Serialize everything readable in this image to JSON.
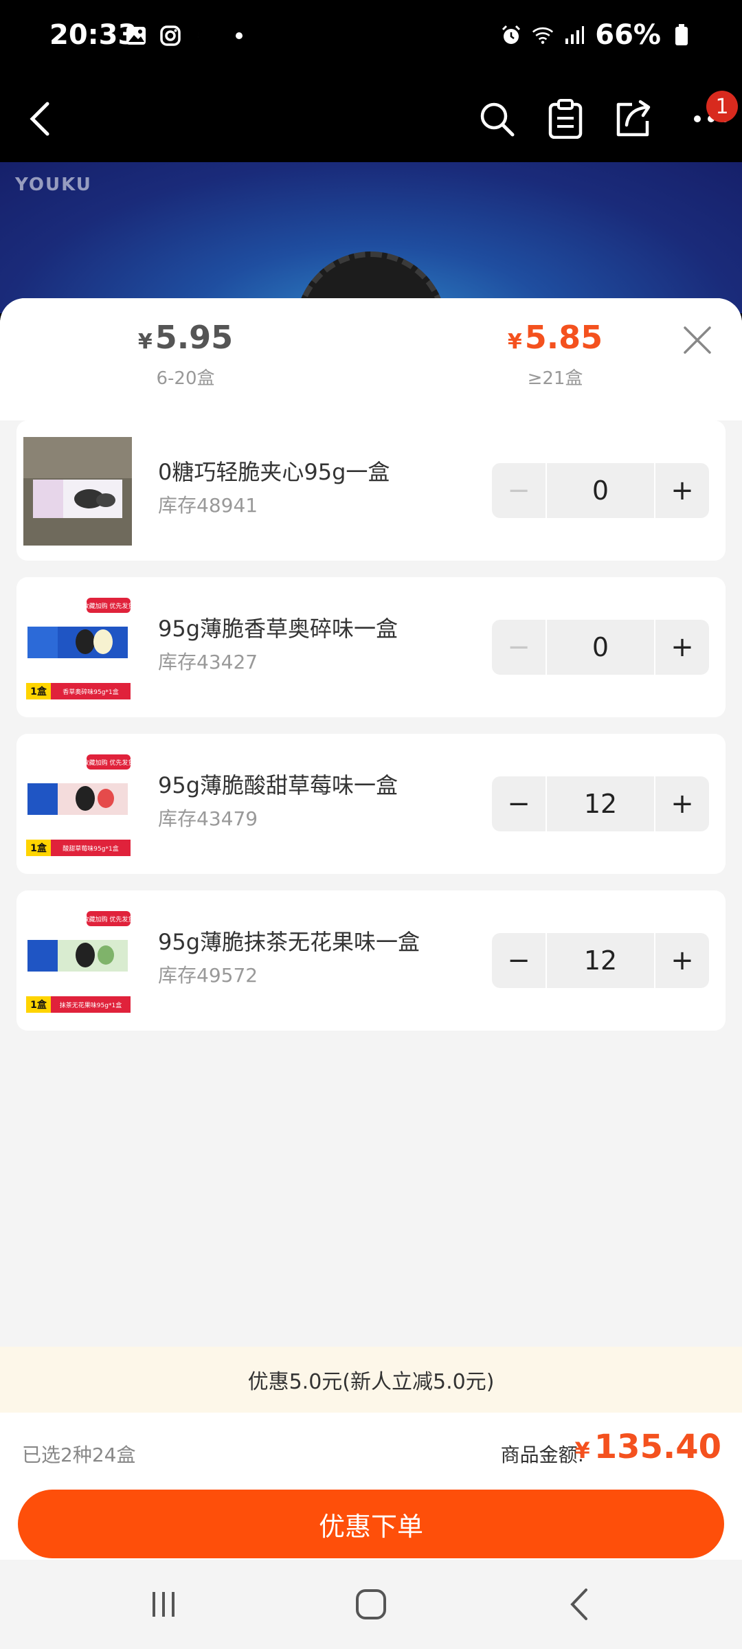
{
  "status_bar": {
    "time": "20:33",
    "battery": "66%"
  },
  "nav": {
    "badge_count": "1"
  },
  "banner": {
    "watermark": "YOUKU"
  },
  "price_tiers": [
    {
      "currency": "¥",
      "price": "5.95",
      "range": "6-20盒",
      "color": "#555555"
    },
    {
      "currency": "¥",
      "price": "5.85",
      "range": "≥21盒",
      "color": "#f4511e"
    }
  ],
  "items": [
    {
      "name": "0糖巧轻脆夹心95g一盒",
      "stock": "库存48941",
      "qty": "0",
      "minus": "−",
      "plus": "+",
      "thumb_label": ""
    },
    {
      "name": "95g薄脆香草奥碎味一盒",
      "stock": "库存43427",
      "qty": "0",
      "minus": "−",
      "plus": "+",
      "thumb_label": "香草奥碎味95g*1盒"
    },
    {
      "name": "95g薄脆酸甜草莓味一盒",
      "stock": "库存43479",
      "qty": "12",
      "minus": "−",
      "plus": "+",
      "thumb_label": "酸甜草莓味95g*1盒"
    },
    {
      "name": "95g薄脆抹茶无花果味一盒",
      "stock": "库存49572",
      "qty": "12",
      "minus": "−",
      "plus": "+",
      "thumb_label": "抹茶无花果味95g*1盒"
    }
  ],
  "thumb_tag": "收藏加购 优先发货",
  "thumb_box": "1盒",
  "promo": "优惠5.0元(新人立减5.0元)",
  "summary": {
    "selected": "已选2种24盒",
    "total_label": "商品金额:",
    "currency": "¥",
    "total": "135.40"
  },
  "order_button": "优惠下单",
  "colors": {
    "accent": "#fe4f0a",
    "price_red": "#f4511e"
  }
}
